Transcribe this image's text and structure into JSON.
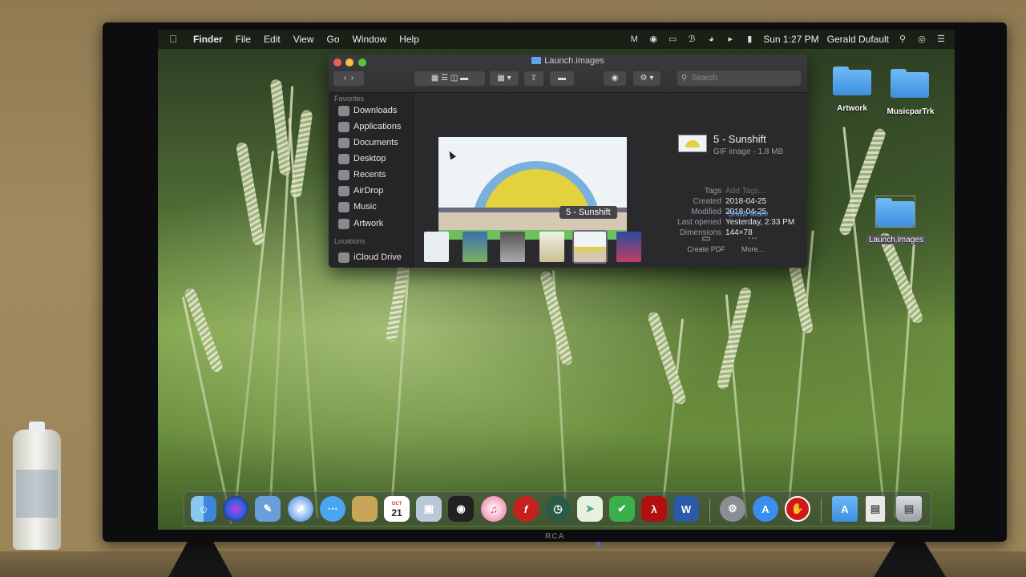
{
  "menubar": {
    "app_name": "Finder",
    "items": [
      "File",
      "Edit",
      "View",
      "Go",
      "Window",
      "Help"
    ],
    "clock": "Sun 1:27 PM",
    "user": "Gerald Dufault",
    "status_icons": [
      "malwarebytes-icon",
      "location-icon",
      "airplay-icon",
      "bluetooth-icon",
      "wifi-icon",
      "volume-icon",
      "battery-icon",
      "search-icon",
      "siri-icon",
      "notification-center-icon"
    ]
  },
  "finder": {
    "title": "Launch.images",
    "search_placeholder": "Search",
    "sidebar": {
      "favorites_heading": "Favorites",
      "favorites": [
        "Downloads",
        "Applications",
        "Documents",
        "Desktop",
        "Recents",
        "AirDrop",
        "Music",
        "Artwork"
      ],
      "locations_heading": "Locations",
      "locations": [
        "iCloud Drive"
      ]
    },
    "selected_caption": "5 - Sunshift",
    "info": {
      "name": "5 - Sunshift",
      "kind": "GIF image - 1.8 MB",
      "tags_label": "Tags",
      "tags_placeholder": "Add Tags...",
      "rows": [
        {
          "label": "Created",
          "value": "2018-04-25"
        },
        {
          "label": "Modified",
          "value": "2018-04-25"
        },
        {
          "label": "Last opened",
          "value": "Yesterday, 2:33 PM"
        },
        {
          "label": "Dimensions",
          "value": "144×78"
        }
      ],
      "show_more": "Show More"
    },
    "actions": {
      "create_pdf": "Create PDF",
      "more": "More..."
    }
  },
  "desktop": {
    "icons": [
      "Artwork",
      "MusicparTrk",
      "Launch.images"
    ]
  },
  "dock": {
    "apps": [
      "finder-icon",
      "siri-icon",
      "preview-icon",
      "safari-icon",
      "messages-icon",
      "notes-icon",
      "calendar-icon",
      "image-capture-icon",
      "dvd-player-icon",
      "itunes-icon",
      "flash-icon",
      "time-machine-icon",
      "maps-icon",
      "adguard-icon",
      "acrobat-icon",
      "word-icon",
      "system-preferences-icon",
      "app-store-icon",
      "stop-icon",
      "applications-folder-icon",
      "documents-stack-icon",
      "trash-icon"
    ],
    "calendar_month": "OCT",
    "calendar_day": "21"
  },
  "tv": {
    "brand": "RCA"
  }
}
